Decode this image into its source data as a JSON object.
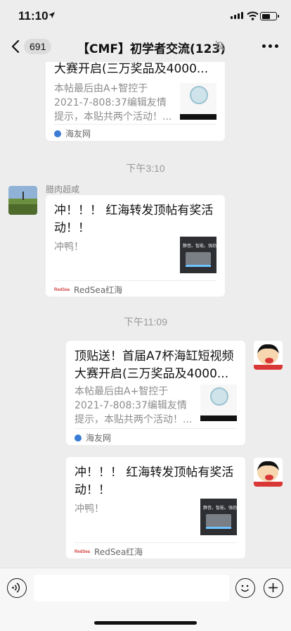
{
  "status": {
    "time": "11:10"
  },
  "nav": {
    "back_count": "691",
    "title": "【CMF】初学者交流(123)"
  },
  "messages": [
    {
      "title": "大赛开启(三万奖品及4000...",
      "desc": "本帖最后由A+智控于2021-7-808:37编辑友情提示，本贴共两个活动！...",
      "source": "海友网"
    },
    {
      "timestamp": "下午3:10"
    },
    {
      "sender": "腊肉超咸",
      "title": "冲！！！ 红海转发顶帖有奖活动！！",
      "desc": "冲鸭！",
      "thumb_text": "静音。智能。强劲",
      "source": "RedSea红海",
      "source_logo": "RedSea"
    },
    {
      "timestamp": "下午11:09"
    },
    {
      "title": "顶贴送！首届A7杯海缸短视频大赛开启(三万奖品及4000...",
      "desc": "本帖最后由A+智控于2021-7-808:37编辑友情提示，本贴共两个活动！...",
      "source": "海友网"
    },
    {
      "title": "冲！！！ 红海转发顶帖有奖活动！！",
      "desc": "冲鸭！",
      "thumb_text": "静音。智能。强劲",
      "source": "RedSea红海",
      "source_logo": "RedSea"
    }
  ],
  "colors": {
    "background": "#ededed",
    "card": "#ffffff",
    "muted": "#8c8c8c"
  }
}
